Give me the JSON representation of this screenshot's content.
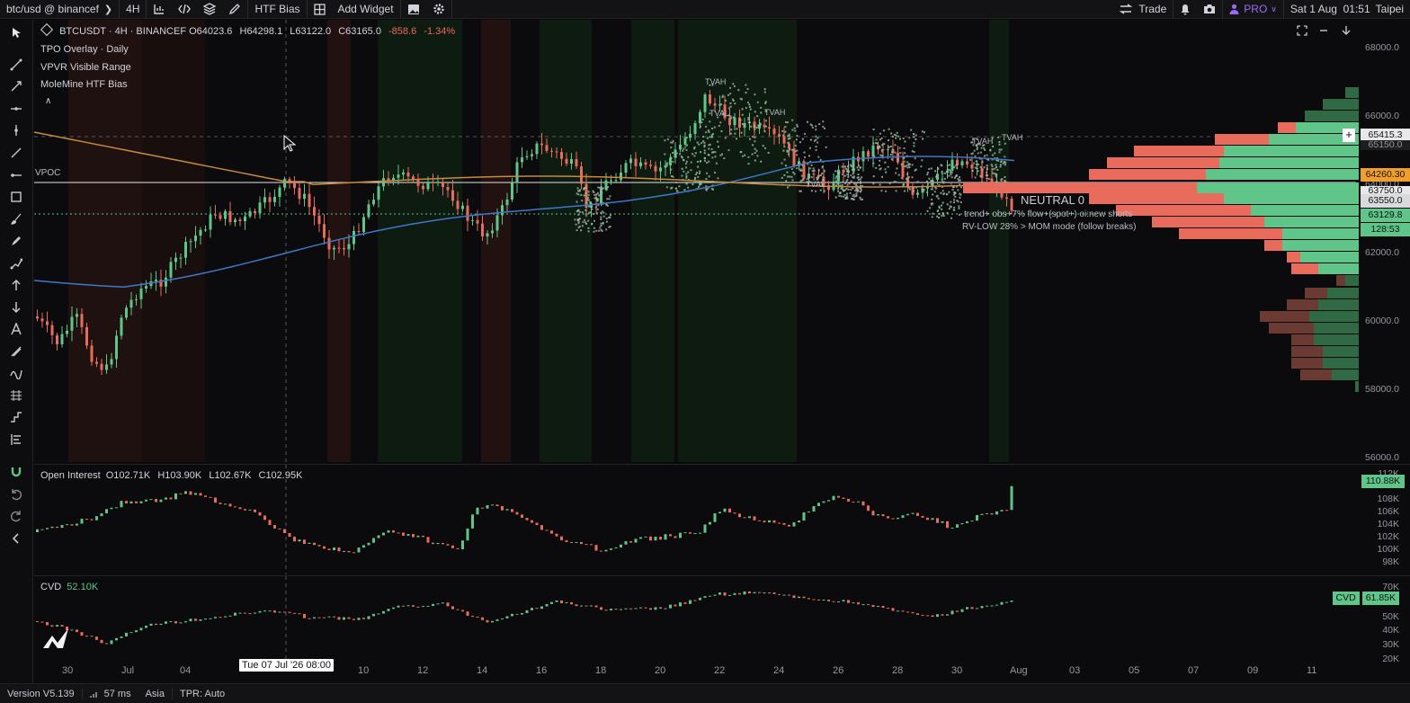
{
  "topbar": {
    "symbol": "btc/usd @ binancef",
    "interval": "4H",
    "htf_bias_label": "HTF Bias",
    "add_widget_label": "Add Widget",
    "trade_label": "Trade",
    "pro_label": "PRO",
    "datetime": "Sat 1 Aug  01:51",
    "timezone": "Taipei"
  },
  "main": {
    "title": "BTCUSDT · 4H · BINANCEF",
    "open": "O64023.6",
    "high": "H64298.1",
    "low": "L63122.0",
    "close": "C63165.0",
    "change": "-858.6",
    "change_pct": "-1.34%",
    "indicators": [
      "TPO Overlay · Daily",
      "VPVR Visible Range",
      "MoleMine HTF Bias"
    ],
    "vpoc_label": "VPOC",
    "neutral_label": "NEUTRAL 0",
    "note_line1": "trend+ obs+7% flow+(spot+) oi:new shorts",
    "note_line2": "RV-LOW 28% > MOM mode (follow breaks)",
    "tpo_labels": [
      "TVAH",
      "TVAH",
      "TVAH",
      "TVAH",
      "TVAL",
      "TVAL"
    ],
    "price_axis": [
      "68000.0",
      "66000.0",
      "64000.0",
      "62000.0",
      "60000.0",
      "58000.0",
      "56000.0"
    ],
    "tags": {
      "crosshair": "65415.3",
      "hidden": "65150.0",
      "current": "64260.30",
      "level1": "63750.0",
      "level2": "63550.0",
      "last": "63129.8",
      "countdown": "128:53"
    }
  },
  "oi": {
    "title": "Open Interest",
    "open": "O102.71K",
    "high": "H103.90K",
    "low": "L102.67K",
    "close": "C102.95K",
    "axis": [
      "112K",
      "108K",
      "106K",
      "104K",
      "102K",
      "100K",
      "98K"
    ],
    "tag": "110.88K"
  },
  "cvd": {
    "title": "CVD",
    "value": "52.10K",
    "axis": [
      "70K",
      "50K",
      "40K",
      "30K",
      "20K"
    ],
    "tag_name": "CVD",
    "tag_value": "61.85K"
  },
  "time_axis": [
    "30",
    "Jul",
    "04",
    "10",
    "12",
    "14",
    "16",
    "18",
    "20",
    "22",
    "24",
    "26",
    "28",
    "30",
    "Aug",
    "03",
    "05",
    "07",
    "09",
    "11"
  ],
  "crosshair_time": "Tue 07 Jul '26 08:00",
  "status": {
    "version": "Version V5.139",
    "latency": "57 ms",
    "region": "Asia",
    "tpr": "TPR: Auto"
  },
  "colors": {
    "up": "#5fc589",
    "down": "#e96b5c",
    "ema_blue": "#3f78c8",
    "ema_orange": "#c88a3c",
    "pro": "#9c6bf5",
    "current_tag": "#f0a02a"
  }
}
